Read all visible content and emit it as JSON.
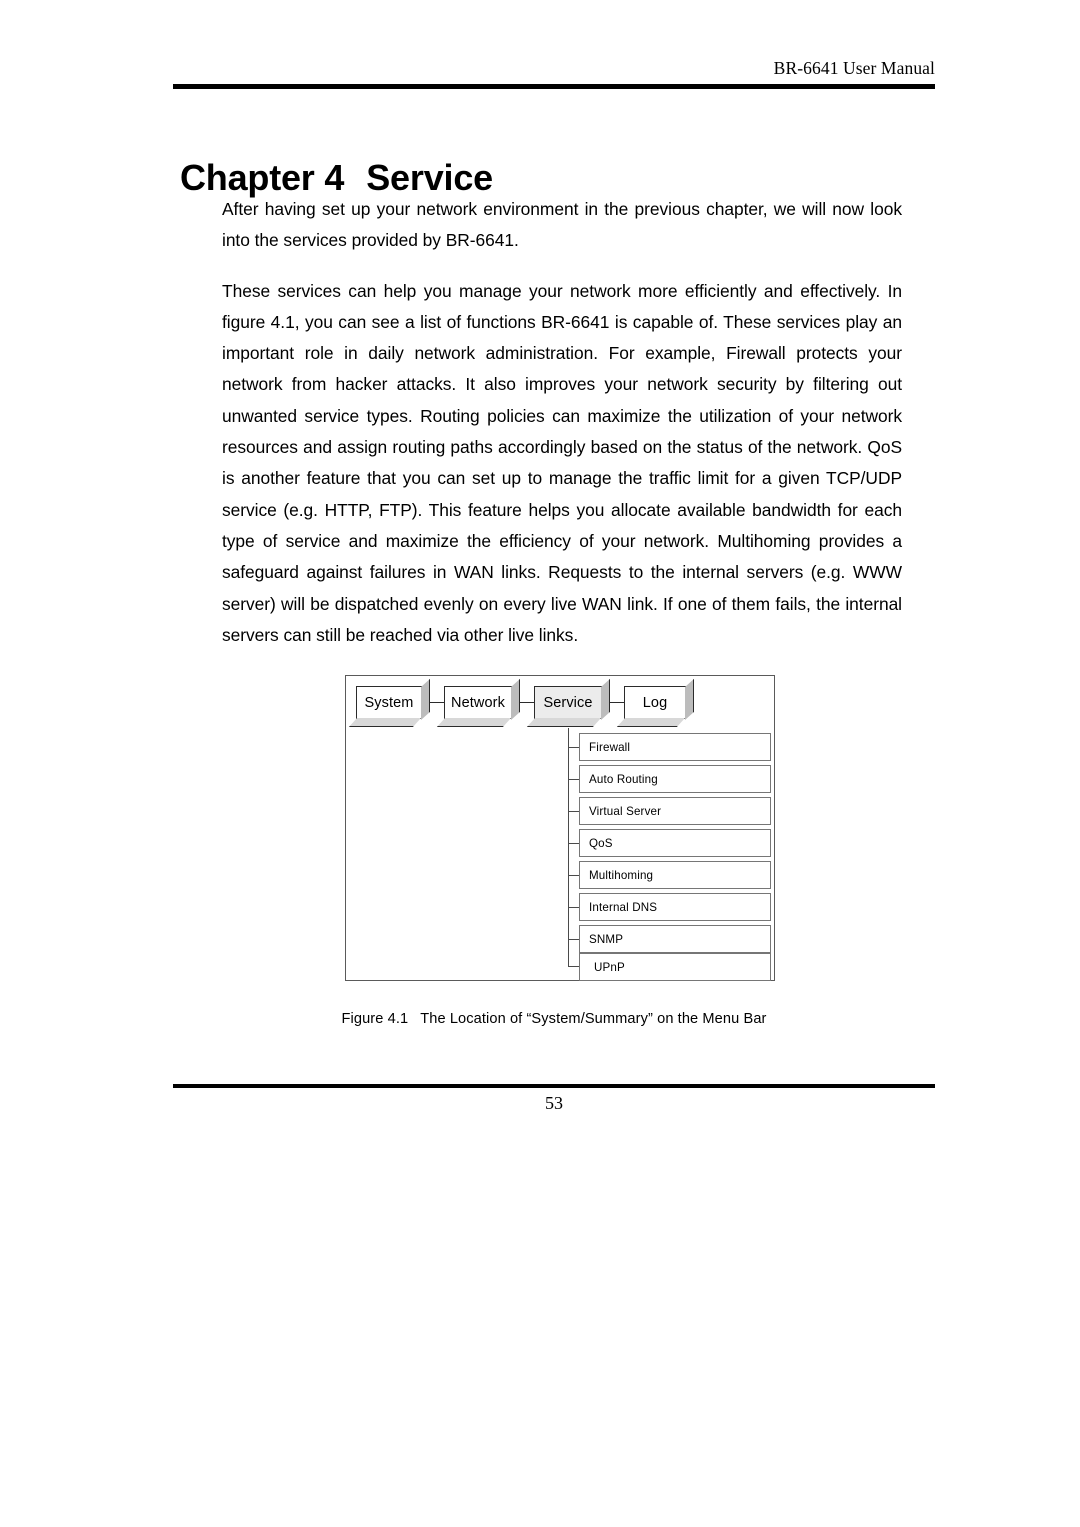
{
  "header": {
    "running_title": "BR-6641 User Manual"
  },
  "chapter": {
    "label": "Chapter 4",
    "title": "Service"
  },
  "body": {
    "paragraphs": [
      "After having set up your network environment in the previous chapter, we will now look into the services provided by BR-6641.",
      "These services can help you manage your network more efficiently and effectively. In figure 4.1, you can see a list of functions BR-6641 is capable of. These services play an important role in daily network administration. For example, Firewall protects your network from hacker attacks. It also improves your network security by filtering out unwanted service types. Routing policies can maximize the utilization of your network resources and assign routing paths accordingly based on the status of the network. QoS is another feature that you can set up to manage the traffic limit for a given TCP/UDP service (e.g. HTTP, FTP). This feature helps you allocate available bandwidth for each type of service and maximize the efficiency of your network. Multihoming provides a safeguard against failures in WAN links. Requests to the internal servers (e.g. WWW server) will be dispatched evenly on every live WAN link. If one of them fails, the internal servers can still be reached via other live links."
    ]
  },
  "figure": {
    "menu_bar": {
      "tabs": [
        {
          "label": "System",
          "selected": false
        },
        {
          "label": "Network",
          "selected": false
        },
        {
          "label": "Service",
          "selected": true
        },
        {
          "label": "Log",
          "selected": false
        }
      ]
    },
    "submenu": {
      "parent": "Service",
      "items": [
        {
          "label": "Firewall"
        },
        {
          "label": "Auto Routing"
        },
        {
          "label": "Virtual Server"
        },
        {
          "label": "QoS"
        },
        {
          "label": "Multihoming"
        },
        {
          "label": "Internal DNS"
        },
        {
          "label": "SNMP"
        },
        {
          "label": "UPnP"
        }
      ]
    },
    "caption_number": "Figure 4.1",
    "caption_text": "The Location of “System/Summary” on the Menu Bar",
    "colors": {
      "selected_tab_fill": "#ececec",
      "tab_shadow": "#bcbcbc",
      "frame_border": "#5a5a5a",
      "box_border": "#767676"
    }
  },
  "footer": {
    "page_number": "53"
  }
}
